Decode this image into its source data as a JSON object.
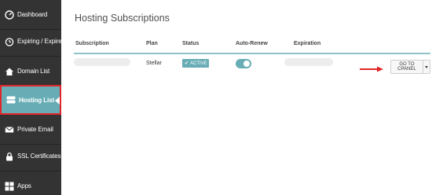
{
  "sidebar": {
    "items": [
      {
        "label": "Dashboard",
        "icon": "dashboard-icon"
      },
      {
        "label": "Expiring / Expired",
        "icon": "clock-icon"
      },
      {
        "label": "Domain List",
        "icon": "home-icon"
      },
      {
        "label": "Hosting List",
        "icon": "server-icon",
        "active": true
      },
      {
        "label": "Private Email",
        "icon": "envelope-icon"
      },
      {
        "label": "SSL Certificates",
        "icon": "lock-icon"
      },
      {
        "label": "Apps",
        "icon": "grid-icon"
      }
    ]
  },
  "main": {
    "title": "Hosting Subscriptions",
    "columns": {
      "subscription": "Subscription",
      "plan": "Plan",
      "status": "Status",
      "auto_renew": "Auto-Renew",
      "expiration": "Expiration"
    },
    "row": {
      "plan": "Stellar",
      "status": "ACTIVE",
      "auto_renew": true,
      "action_label": "GO TO CPANEL"
    }
  },
  "colors": {
    "sidebar_bg": "#333333",
    "accent": "#68adb5",
    "highlight_border": "#e0262a",
    "arrow": "#e0262a"
  }
}
